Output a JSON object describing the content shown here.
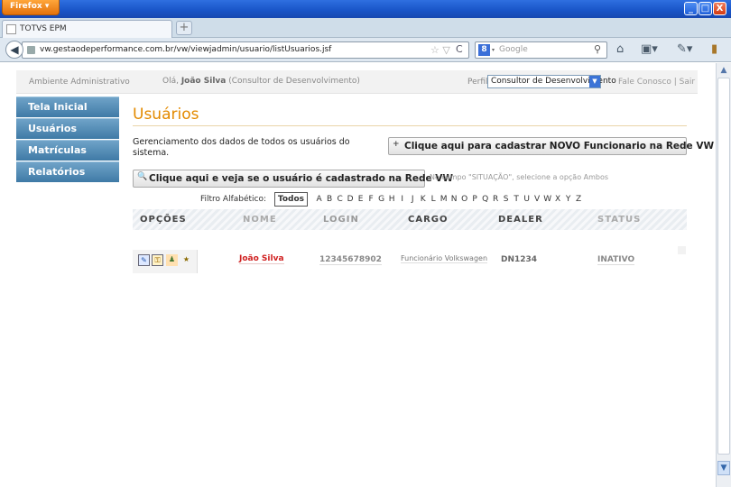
{
  "browser": {
    "menu_button": "Firefox ▾",
    "window_buttons": {
      "minimize": "_",
      "maximize": "□",
      "close": "X"
    },
    "tab": {
      "title": "TOTVS EPM",
      "new_tab": "+"
    },
    "url": "vw.gestaodeperformance.com.br/vw/viewjadmin/usuario/listUsuarios.jsf",
    "url_star": "☆ ▽",
    "reload": "C",
    "search": {
      "engine_icon": "8",
      "engine_caret": "▾",
      "placeholder": "Google",
      "icon": "search-icon"
    },
    "icons": [
      "home-icon",
      "layout-icon",
      "addon-icon",
      "bookmarks-icon"
    ]
  },
  "header": {
    "environment": "Ambiente Administrativo",
    "greeting_prefix": "Olá, ",
    "user_name": "João Silva",
    "user_role": " (Consultor de Desenvolvimento)",
    "profile_label": "Perfil",
    "profile_value": "Consultor de Desenvolvimento",
    "contact": "Fale Conosco  |  Sair"
  },
  "sidebar": {
    "items": [
      {
        "label": "Tela Inicial"
      },
      {
        "label": "Usuários"
      },
      {
        "label": "Matrículas"
      },
      {
        "label": "Relatórios"
      }
    ]
  },
  "main": {
    "title": "Usuários",
    "description": "Gerenciamento dos dados de todos os usuários do sistema.",
    "new_button": "Clique aqui para cadastrar NOVO Funcionario na Rede VW",
    "new_button_icon": "+",
    "check_button": "Clique aqui e veja se o usuário é cadastrado na Rede VW",
    "check_button_icon": "🔍",
    "check_note": "No campo \"SITUAÇÃO\", selecione a opção Ambos",
    "alpha_filter": {
      "label": "Filtro Alfabético:",
      "all": "Todos",
      "letters": [
        "A",
        "B",
        "C",
        "D",
        "E",
        "F",
        "G",
        "H",
        "I",
        "J",
        "K",
        "L",
        "M",
        "N",
        "O",
        "P",
        "Q",
        "R",
        "S",
        "T",
        "U",
        "V",
        "W",
        "X",
        "Y",
        "Z"
      ]
    },
    "table": {
      "headers": {
        "opcoes": "OPÇÕES",
        "nome": "NOME",
        "login": "LOGIN",
        "cargo": "CARGO",
        "dealer": "DEALER",
        "status": "STATUS"
      },
      "header_colors": {
        "opcoes": "#444444",
        "nome": "#aaaaaa",
        "login": "#999999",
        "cargo": "#444444",
        "dealer": "#444444",
        "status": "#aaaaaa"
      },
      "rows": [
        {
          "actions": [
            "edit-icon",
            "key-icon",
            "users-icon",
            "graduate-icon"
          ],
          "nome": "João Silva",
          "login": "12345678902",
          "cargo": "Funcionário Volkswagen",
          "dealer": "DN1234",
          "status": "INATIVO"
        }
      ]
    }
  },
  "colors": {
    "accent": "#e38a00",
    "sidebar": "#4f8ab5",
    "name_link": "#d02020"
  }
}
